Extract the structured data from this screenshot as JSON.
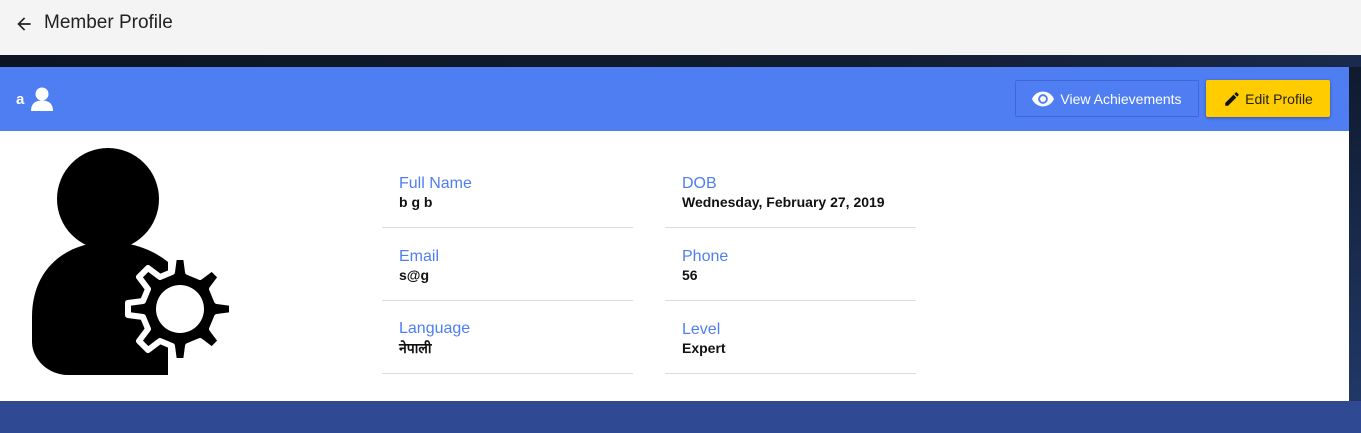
{
  "header": {
    "title": "Member Profile",
    "back_icon": "arrow-left-icon"
  },
  "profile_card": {
    "username": "a",
    "user_icon": "person-icon",
    "accent_color": "#4f7ef2",
    "actions": {
      "view_achievements_label": "View Achievements",
      "view_achievements_icon": "eye-icon",
      "edit_profile_label": "Edit Profile",
      "edit_profile_icon": "pencil-icon",
      "edit_color": "#ffcc00"
    },
    "avatar_icon": "user-settings-icon",
    "fields": {
      "full_name": {
        "label": "Full Name",
        "value": "b g b"
      },
      "dob": {
        "label": "DOB",
        "value": "Wednesday, February 27, 2019"
      },
      "email": {
        "label": "Email",
        "value": "s@g"
      },
      "phone": {
        "label": "Phone",
        "value": "56"
      },
      "language": {
        "label": "Language",
        "value": "नेपाली"
      },
      "level": {
        "label": "Level",
        "value": "Expert"
      }
    }
  }
}
